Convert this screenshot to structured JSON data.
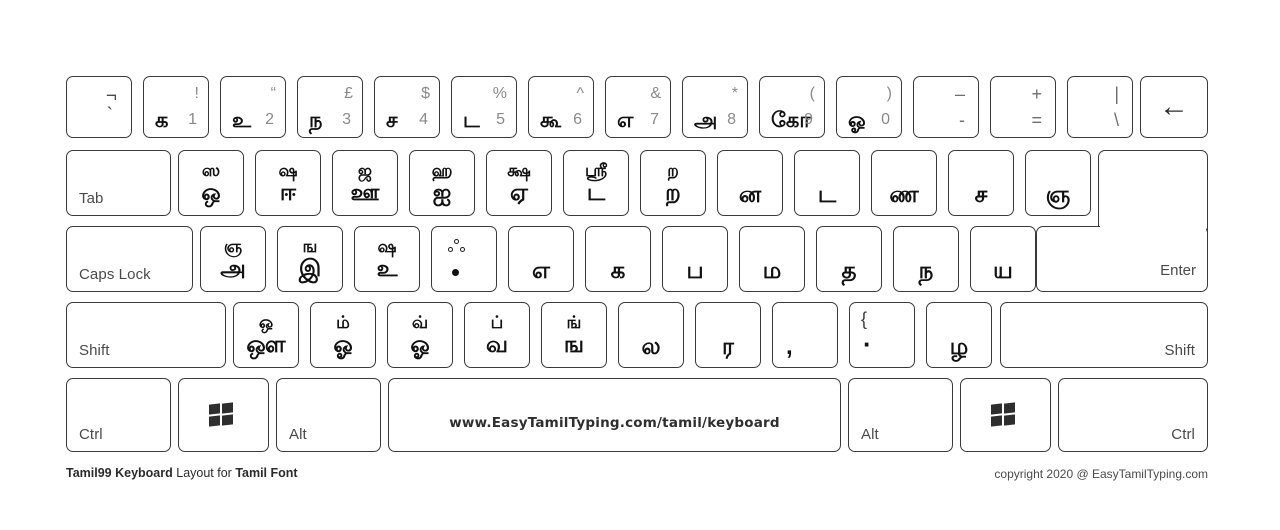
{
  "meta": {
    "title": "Tamil99 Keyboard Layout for Tamil Font",
    "footer_left_bold_1": "Tamil99 Keyboard",
    "footer_left_normal": " Layout for ",
    "footer_left_bold_2": "Tamil Font",
    "footer_right": "copyright 2020 @ EasyTamilTyping.com",
    "spacebar_url": "www.EasyTamilTyping.com/tamil/keyboard",
    "key_border_color": "#3a3a3a",
    "key_face_color": "#ffffff",
    "primary_glyph_color": "#111111",
    "secondary_glyph_color": "#8a8a8a"
  },
  "rows": {
    "number_row": [
      {
        "id": "backquote",
        "top_right": "¬",
        "bottom_right": "`"
      },
      {
        "id": "digit1",
        "top_right": "!",
        "bottom_left": "க",
        "bottom_right": "1"
      },
      {
        "id": "digit2",
        "top_right": "“",
        "bottom_left": "உ",
        "bottom_right": "2"
      },
      {
        "id": "digit3",
        "top_right": "£",
        "bottom_left": "ந",
        "bottom_right": "3"
      },
      {
        "id": "digit4",
        "top_right": "$",
        "bottom_left": "ச",
        "bottom_right": "4"
      },
      {
        "id": "digit5",
        "top_right": "%",
        "bottom_left": "ட",
        "bottom_right": "5"
      },
      {
        "id": "digit6",
        "top_right": "^",
        "bottom_left": "கூ",
        "bottom_right": "6"
      },
      {
        "id": "digit7",
        "top_right": "&",
        "bottom_left": "எ",
        "bottom_right": "7"
      },
      {
        "id": "digit8",
        "top_right": "*",
        "bottom_left": "அ",
        "bottom_right": "8"
      },
      {
        "id": "digit9",
        "top_right": "(",
        "bottom_left": "கோ",
        "bottom_right": "9"
      },
      {
        "id": "digit0",
        "top_right": ")",
        "bottom_left": "ஓ",
        "bottom_right": "0"
      },
      {
        "id": "minus",
        "top_right": "–",
        "bottom_right": "-"
      },
      {
        "id": "equal",
        "top_right": "+",
        "bottom_right": "="
      },
      {
        "id": "backslash",
        "top_right": "|",
        "bottom_right": "\\"
      },
      {
        "id": "backspace",
        "glyph": "←"
      }
    ],
    "tab_row": [
      {
        "id": "tab",
        "name": "Tab"
      },
      {
        "id": "q",
        "upper": "ஸ",
        "lower": "ஒ"
      },
      {
        "id": "w",
        "upper": "ஷ",
        "lower": "ஈ"
      },
      {
        "id": "e",
        "upper": "ஜ",
        "lower": "ஊ"
      },
      {
        "id": "r",
        "upper": "ஹ",
        "lower": "ஐ"
      },
      {
        "id": "t",
        "upper": "க்ஷ",
        "lower": "ஏ"
      },
      {
        "id": "y",
        "upper": "ஶ்ரீ",
        "lower": "ட"
      },
      {
        "id": "u",
        "upper": "ற",
        "lower": "ற"
      },
      {
        "id": "i",
        "lower": "ன"
      },
      {
        "id": "o",
        "lower": "ட"
      },
      {
        "id": "p",
        "lower": "ண"
      },
      {
        "id": "bracketleft",
        "lower": "ச"
      },
      {
        "id": "bracketright",
        "lower": "ஞ"
      }
    ],
    "caps_row": [
      {
        "id": "capslock",
        "name": "Caps Lock"
      },
      {
        "id": "a",
        "upper": "ஞ",
        "lower": "அ"
      },
      {
        "id": "s",
        "upper": "ங",
        "lower": "இ"
      },
      {
        "id": "d",
        "upper": "ஷ",
        "lower": "உ"
      },
      {
        "id": "f",
        "special": "aytham"
      },
      {
        "id": "g",
        "lower": "எ"
      },
      {
        "id": "h",
        "lower": "க"
      },
      {
        "id": "j",
        "lower": "ப"
      },
      {
        "id": "k",
        "lower": "ம"
      },
      {
        "id": "l",
        "lower": "த"
      },
      {
        "id": "semicolon",
        "lower": "ந"
      },
      {
        "id": "quote",
        "lower": "ய"
      },
      {
        "id": "enter",
        "name": "Enter"
      }
    ],
    "shift_row": [
      {
        "id": "shift-left",
        "name": "Shift"
      },
      {
        "id": "z",
        "upper": "ஒ",
        "lower": "ஔ"
      },
      {
        "id": "x",
        "upper": "ம்",
        "lower": "ஓ"
      },
      {
        "id": "c",
        "upper": "வ்",
        "lower": "ஓ"
      },
      {
        "id": "v",
        "upper": "ப்",
        "lower": "வ"
      },
      {
        "id": "b",
        "upper": "ங்",
        "lower": "ங"
      },
      {
        "id": "n",
        "lower": "ல"
      },
      {
        "id": "m",
        "lower": "ர"
      },
      {
        "id": "comma",
        "bottom_left": ","
      },
      {
        "id": "period",
        "top_right": "{",
        "bottom_dot": "·"
      },
      {
        "id": "slash",
        "lower": "ழ"
      },
      {
        "id": "shift-right",
        "name": "Shift"
      }
    ],
    "bottom_row": [
      {
        "id": "ctrl-left",
        "name": "Ctrl"
      },
      {
        "id": "win-left",
        "icon": "windows-icon"
      },
      {
        "id": "alt-left",
        "name": "Alt"
      },
      {
        "id": "space",
        "url": "www.EasyTamilTyping.com/tamil/keyboard"
      },
      {
        "id": "alt-right",
        "name": "Alt"
      },
      {
        "id": "win-right",
        "icon": "windows-icon"
      },
      {
        "id": "ctrl-right",
        "name": "Ctrl"
      }
    ]
  }
}
